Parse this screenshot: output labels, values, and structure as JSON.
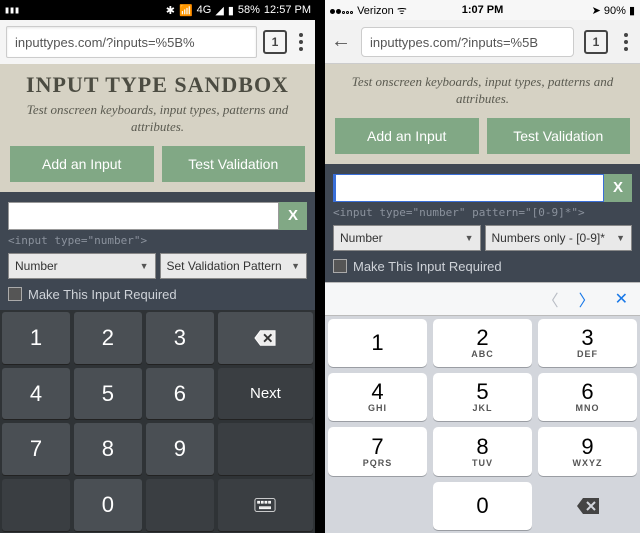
{
  "android": {
    "status": {
      "battery": "58%",
      "time": "12:57 PM",
      "net": "4G"
    },
    "url": "inputtypes.com/?inputs=%5B%",
    "tabcount": "1",
    "app": {
      "title": "INPUT TYPE SANDBOX",
      "subtitle": "Test onscreen keyboards, input types, patterns and attributes.",
      "btn_add": "Add an Input",
      "btn_test": "Test Validation",
      "tag": "<input type=\"number\">",
      "sel_type": "Number",
      "sel_pattern": "Set Validation Pattern",
      "chk_label": "Make This Input Required",
      "clear": "X"
    },
    "kbd": {
      "r1": [
        "1",
        "2",
        "3"
      ],
      "back": "⌫",
      "r2": [
        "4",
        "5",
        "6"
      ],
      "next": "Next",
      "r3": [
        "7",
        "8",
        "9"
      ],
      "r4_zero": "0"
    }
  },
  "ios": {
    "status": {
      "carrier": "Verizon",
      "time": "1:07 PM",
      "battery": "90%"
    },
    "url": "inputtypes.com/?inputs=%5B",
    "tabcount": "1",
    "app": {
      "subtitle": "Test onscreen keyboards, input types, patterns and attributes.",
      "btn_add": "Add an Input",
      "btn_test": "Test Validation",
      "tag": "<input type=\"number\" pattern=\"[0-9]*\">",
      "sel_type": "Number",
      "sel_pattern": "Numbers only - [0-9]*",
      "chk_label": "Make This Input Required",
      "clear": "X"
    },
    "kbd": {
      "keys": [
        {
          "n": "1",
          "s": ""
        },
        {
          "n": "2",
          "s": "ABC"
        },
        {
          "n": "3",
          "s": "DEF"
        },
        {
          "n": "4",
          "s": "GHI"
        },
        {
          "n": "5",
          "s": "JKL"
        },
        {
          "n": "6",
          "s": "MNO"
        },
        {
          "n": "7",
          "s": "PQRS"
        },
        {
          "n": "8",
          "s": "TUV"
        },
        {
          "n": "9",
          "s": "WXYZ"
        },
        {
          "n": "0",
          "s": ""
        }
      ]
    }
  }
}
